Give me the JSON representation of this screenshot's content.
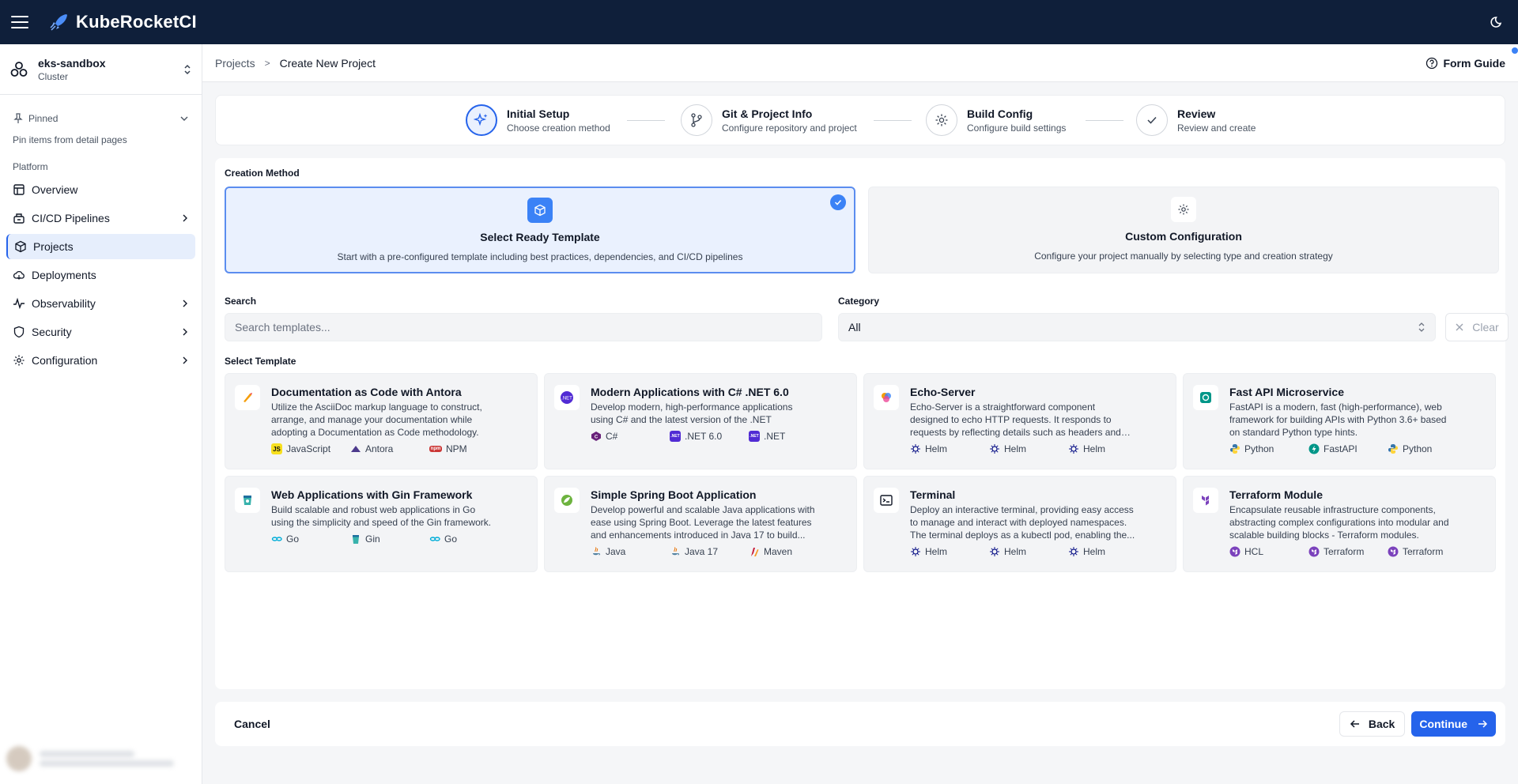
{
  "app": {
    "title": "KubeRocketCI"
  },
  "cluster": {
    "name": "eks-sandbox",
    "type": "Cluster"
  },
  "sidebar": {
    "pinned_label": "Pinned",
    "pinned_hint": "Pin items from detail pages",
    "section": "Platform",
    "items": [
      {
        "label": "Overview",
        "icon": "overview-icon",
        "has_children": false
      },
      {
        "label": "CI/CD Pipelines",
        "icon": "pipeline-icon",
        "has_children": true
      },
      {
        "label": "Projects",
        "icon": "box-icon",
        "has_children": false,
        "active": true
      },
      {
        "label": "Deployments",
        "icon": "cloud-icon",
        "has_children": false
      },
      {
        "label": "Observability",
        "icon": "pulse-icon",
        "has_children": true
      },
      {
        "label": "Security",
        "icon": "shield-icon",
        "has_children": true
      },
      {
        "label": "Configuration",
        "icon": "gear-icon",
        "has_children": true
      }
    ]
  },
  "breadcrumb": {
    "parent": "Projects",
    "current": "Create New Project"
  },
  "form_guide": "Form Guide",
  "steps": [
    {
      "name": "Initial Setup",
      "desc": "Choose creation method",
      "active": true
    },
    {
      "name": "Git & Project Info",
      "desc": "Configure repository and project"
    },
    {
      "name": "Build Config",
      "desc": "Configure build settings"
    },
    {
      "name": "Review",
      "desc": "Review and create"
    }
  ],
  "creation_method": {
    "label": "Creation Method",
    "options": [
      {
        "title": "Select Ready Template",
        "desc": "Start with a pre-configured template including best practices, dependencies, and CI/CD pipelines",
        "selected": true
      },
      {
        "title": "Custom Configuration",
        "desc": "Configure your project manually by selecting type and creation strategy",
        "selected": false
      }
    ]
  },
  "search": {
    "label": "Search",
    "placeholder": "Search templates...",
    "value": ""
  },
  "category": {
    "label": "Category",
    "value": "All"
  },
  "clear_label": "Clear",
  "templates_label": "Select Template",
  "templates": [
    {
      "title": "Documentation as Code with Antora",
      "desc": "Utilize the AsciiDoc markup language to construct, arrange, and manage your documentation while adopting a Documentation as Code methodology.",
      "tags": [
        "JavaScript",
        "Antora",
        "NPM"
      ],
      "logo": "antora-logo"
    },
    {
      "title": "Modern Applications with C# .NET 6.0",
      "desc": "Develop modern, high-performance applications using C# and the latest version of the .NET framework.",
      "tags": [
        "C#",
        ".NET 6.0",
        ".NET"
      ],
      "logo": "dotnet-logo"
    },
    {
      "title": "Echo-Server",
      "desc": "Echo-Server is a straightforward component designed to echo HTTP requests. It responds to requests by reflecting details such as headers and body, making i...",
      "tags": [
        "Helm",
        "Helm",
        "Helm"
      ],
      "logo": "echo-server-logo"
    },
    {
      "title": "Fast API Microservice",
      "desc": "FastAPI is a modern, fast (high-performance), web framework for building APIs with Python 3.6+ based on standard Python type hints.",
      "tags": [
        "Python",
        "FastAPI",
        "Python"
      ],
      "logo": "fastapi-logo"
    },
    {
      "title": "Web Applications with Gin Framework",
      "desc": "Build scalable and robust web applications in Go using the simplicity and speed of the Gin framework.",
      "tags": [
        "Go",
        "Gin",
        "Go"
      ],
      "logo": "gin-logo"
    },
    {
      "title": "Simple Spring Boot Application",
      "desc": "Develop powerful and scalable Java applications with ease using Spring Boot. Leverage the latest features and enhancements introduced in Java 17 to build...",
      "tags": [
        "Java",
        "Java 17",
        "Maven"
      ],
      "logo": "spring-logo"
    },
    {
      "title": "Terminal",
      "desc": "Deploy an interactive terminal, providing easy access to manage and interact with deployed namespaces. The terminal deploys as a kubectl pod, enabling the...",
      "tags": [
        "Helm",
        "Helm",
        "Helm"
      ],
      "logo": "terminal-logo"
    },
    {
      "title": "Terraform Module",
      "desc": "Encapsulate reusable infrastructure components, abstracting complex configurations into modular and scalable building blocks - Terraform modules.",
      "tags": [
        "HCL",
        "Terraform",
        "Terraform"
      ],
      "logo": "terraform-logo"
    }
  ],
  "footer": {
    "cancel": "Cancel",
    "back": "Back",
    "continue": "Continue"
  },
  "colors": {
    "topbar": "#0f1f3a",
    "accent": "#2563eb",
    "selected_bg": "#eaf1fe"
  }
}
